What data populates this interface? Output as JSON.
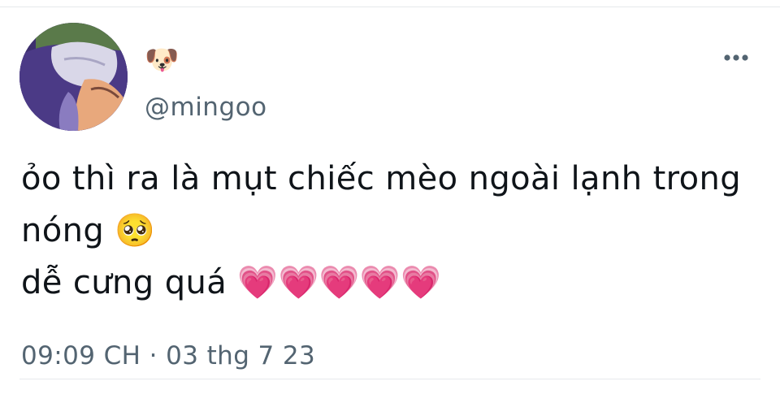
{
  "tweet": {
    "display_name_emoji": "🐶",
    "handle": "@mingoo",
    "more_icon": "more-dots-icon",
    "lines": [
      "ỏo thì ra là mụt chiếc mèo ngoài lạnh trong",
      "nóng 🥺",
      "dễ cưng quá 💗💗💗💗💗"
    ],
    "timestamp": "09:09 CH · 03 thg 7 23"
  },
  "colors": {
    "text": "#0f1419",
    "secondary_text": "#536471",
    "divider": "#e6e9ec",
    "heart": "#f03c9e"
  }
}
